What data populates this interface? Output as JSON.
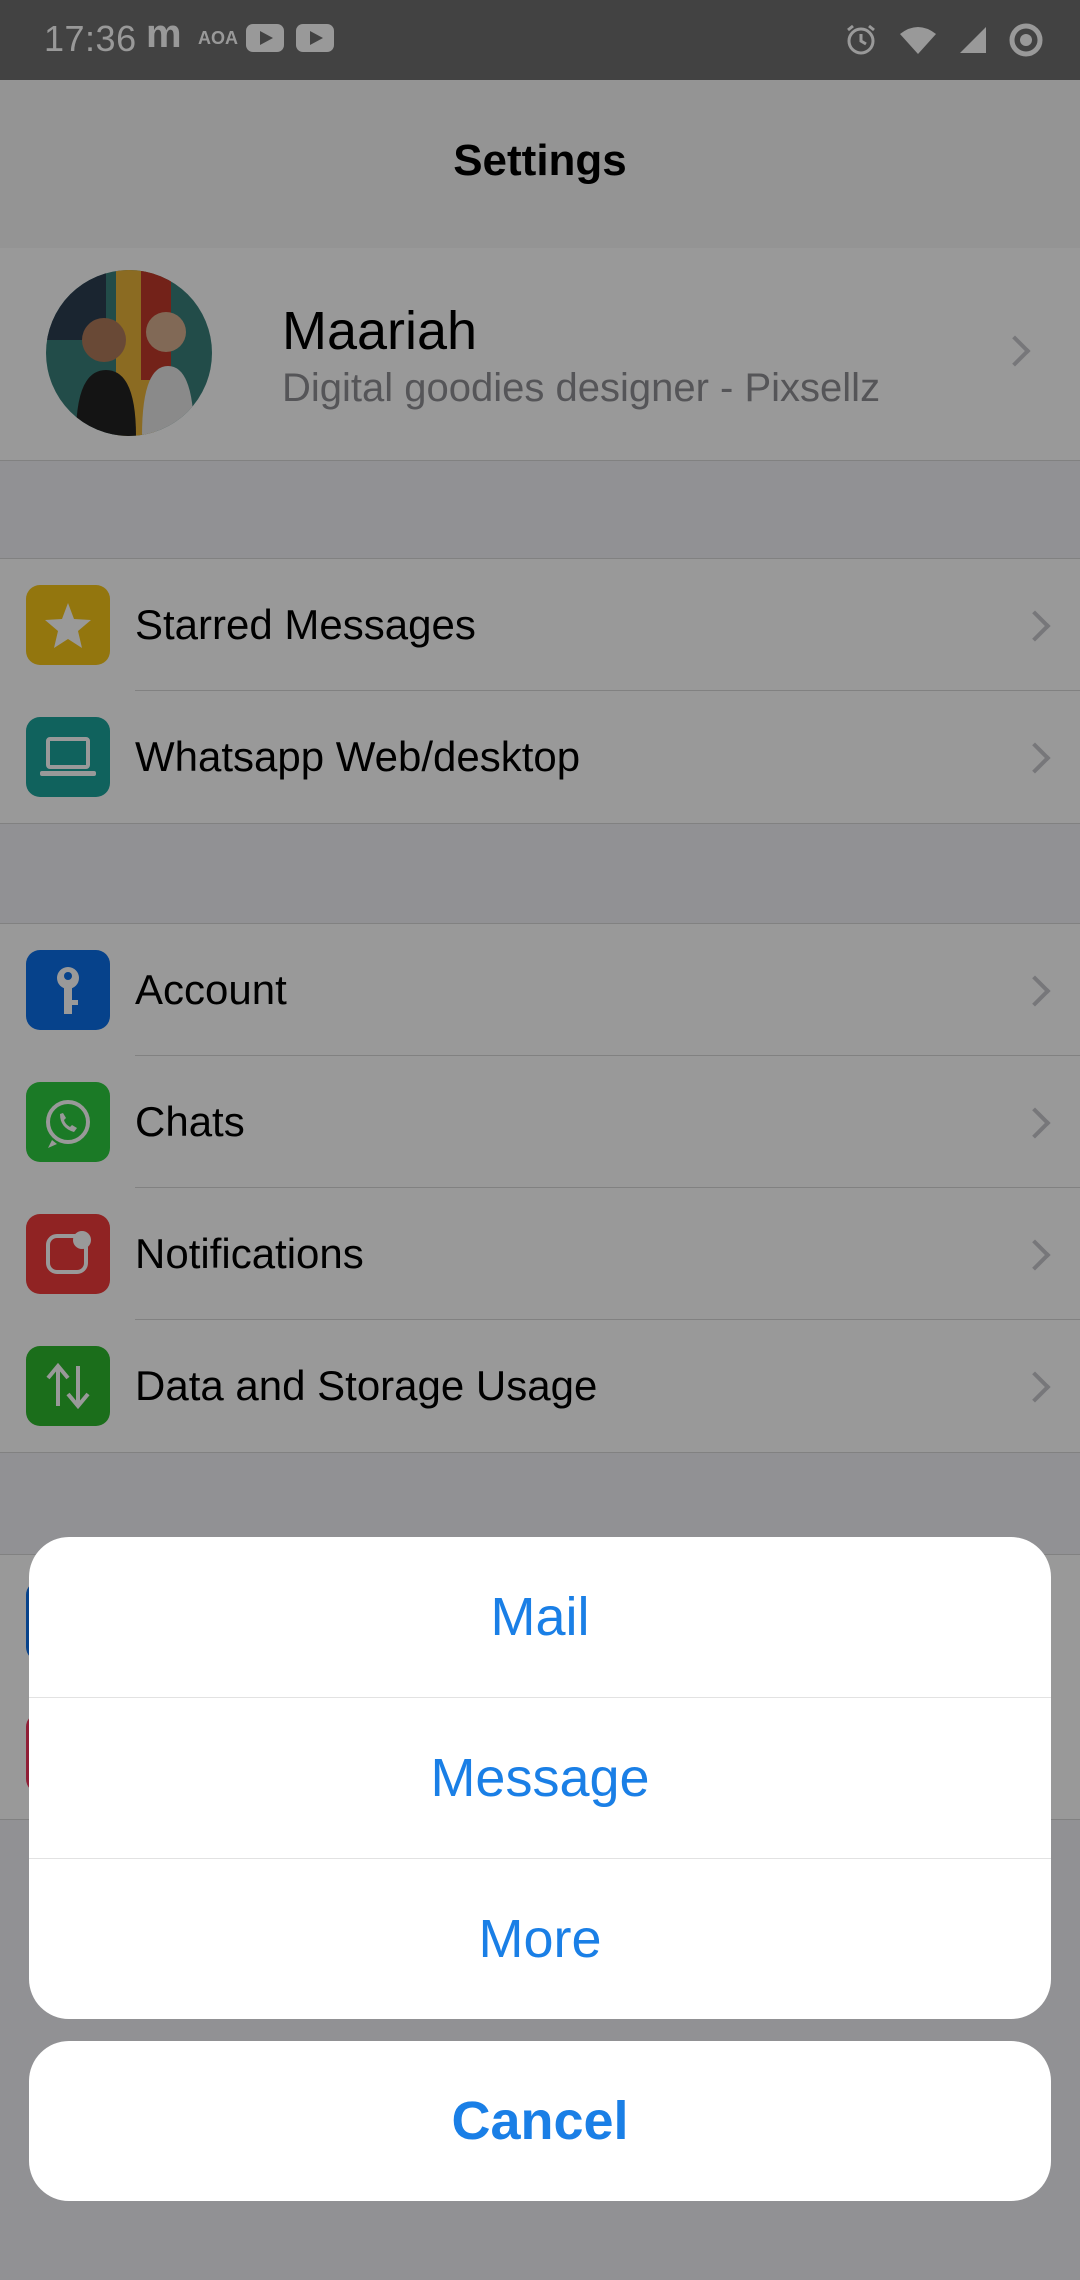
{
  "status_bar": {
    "time": "17:36",
    "app_m": "m",
    "app_aoa": "AOA"
  },
  "nav": {
    "title": "Settings"
  },
  "profile": {
    "name": "Maariah",
    "status": "Digital goodies designer - Pixsellz"
  },
  "groups": [
    {
      "items": [
        {
          "label": "Starred Messages",
          "icon": "star-icon",
          "color": "#f5c518"
        },
        {
          "label": "Whatsapp Web/desktop",
          "icon": "laptop-icon",
          "color": "#1ba39c"
        }
      ]
    },
    {
      "items": [
        {
          "label": "Account",
          "icon": "key-icon",
          "color": "#0a6fe8"
        },
        {
          "label": "Chats",
          "icon": "whatsapp-icon",
          "color": "#2ecc40"
        },
        {
          "label": "Notifications",
          "icon": "notification-icon",
          "color": "#f03b3b"
        },
        {
          "label": "Data and Storage Usage",
          "icon": "arrows-updown-icon",
          "color": "#2eb82e"
        }
      ]
    }
  ],
  "action_sheet": {
    "options": [
      "Mail",
      "Message",
      "More"
    ],
    "cancel": "Cancel",
    "accent_color": "#1a7fe6"
  }
}
